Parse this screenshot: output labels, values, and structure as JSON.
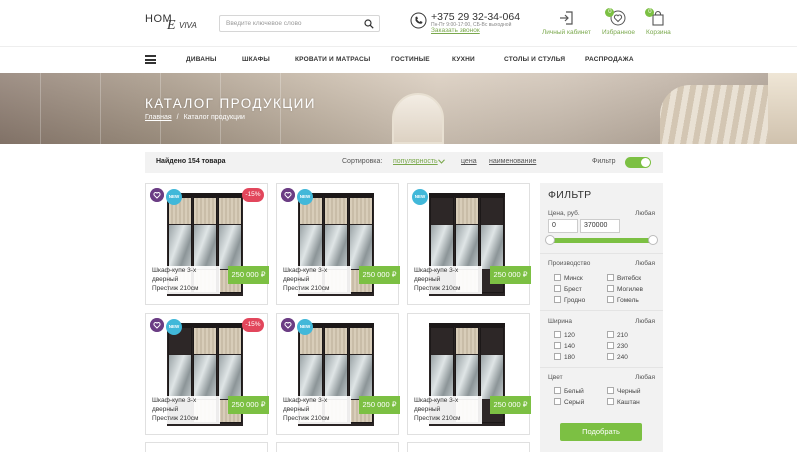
{
  "header": {
    "logo": {
      "part1": "HOM",
      "part2": "E",
      "part3": "VIVA"
    },
    "search": {
      "placeholder": "Введите ключевое слово"
    },
    "phone": "+375 29 32-34-064",
    "hours": "Пн-Пт 9:00-17:00, СБ-Вс выходной",
    "callback": "Заказать звонок",
    "account_label": "Личный кабинет",
    "favorites_label": "Избранное",
    "favorites_count": "0",
    "cart_label": "Корзина",
    "cart_count": "0"
  },
  "nav": [
    "ДИВАНЫ",
    "ШКАФЫ",
    "КРОВАТИ И МАТРАСЫ",
    "ГОСТИНЫЕ",
    "КУХНИ",
    "СТОЛЫ И СТУЛЬЯ",
    "РАСПРОДАЖА"
  ],
  "banner": {
    "title": "КАТАЛОГ ПРОДУКЦИИ",
    "crumb_home": "Главная",
    "crumb_sep": "/",
    "crumb_current": "Каталог продукции"
  },
  "toolbar": {
    "found": "Найдено 154 товара",
    "sort_label": "Сортировка:",
    "sort_options": [
      "популярность",
      "цена",
      "наименование"
    ],
    "filter_label": "Фильтр"
  },
  "products": [
    {
      "line1": "Шкаф-купе 3-х",
      "line2": "дверный",
      "line3": "Престиж 210см",
      "price": "250 000 ₽",
      "new": "NEW",
      "sale": "-15%"
    },
    {
      "line1": "Шкаф-купе 3-х",
      "line2": "дверный",
      "line3": "Престиж 210см",
      "price": "250 000 ₽",
      "new": "NEW",
      "sale": ""
    },
    {
      "line1": "Шкаф-купе 3-х",
      "line2": "дверный",
      "line3": "Престиж 210см",
      "price": "250 000 ₽",
      "new": "NEW",
      "sale": ""
    },
    {
      "line1": "Шкаф-купе 3-х",
      "line2": "дверный",
      "line3": "Престиж 210см",
      "price": "250 000 ₽",
      "new": "NEW",
      "sale": "-15%"
    },
    {
      "line1": "Шкаф-купе 3-х",
      "line2": "дверный",
      "line3": "Престиж 210см",
      "price": "250 000 ₽",
      "new": "NEW",
      "sale": ""
    },
    {
      "line1": "Шкаф-купе 3-х",
      "line2": "дверный",
      "line3": "Престиж 210см",
      "price": "250 000 ₽",
      "new": "",
      "sale": ""
    }
  ],
  "filter": {
    "title": "ФИЛЬТР",
    "price_label": "Цена, руб.",
    "any": "Любая",
    "price_min": "0",
    "price_max": "370000",
    "producer_label": "Производство",
    "producers": [
      "Минск",
      "Витебск",
      "Брест",
      "Могилев",
      "Гродно",
      "Гомель"
    ],
    "width_label": "Ширина",
    "widths": [
      "120",
      "210",
      "140",
      "230",
      "180",
      "240"
    ],
    "color_label": "Цвет",
    "colors": [
      "Белый",
      "Черный",
      "Серый",
      "Каштан"
    ],
    "submit": "Подобрать"
  }
}
